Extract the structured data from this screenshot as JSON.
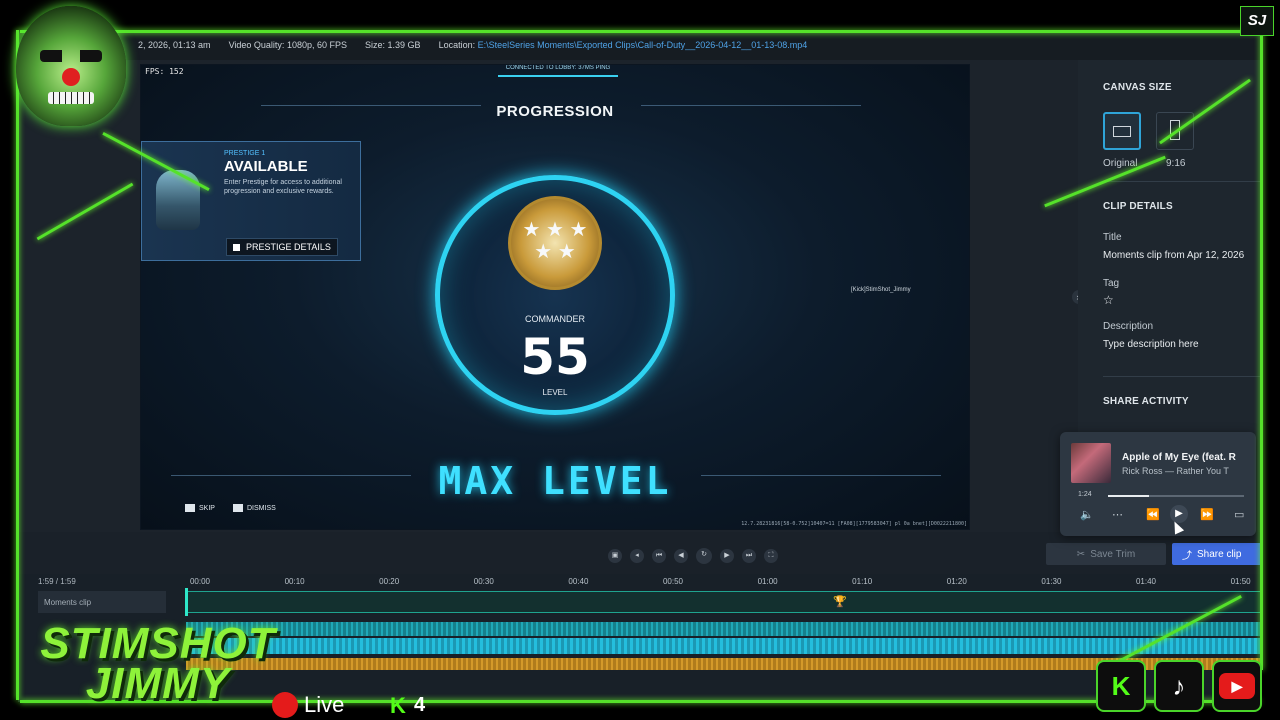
{
  "meta_bar": {
    "date": "2, 2026, 01:13 am",
    "quality_label": "Video Quality:",
    "quality_value": "1080p, 60 FPS",
    "size_label": "Size:",
    "size_value": "1.39 GB",
    "location_label": "Location:",
    "location_value": "E:\\SteelSeries Moments\\Exported Clips\\Call-of-Duty__2026-04-12__01-13-08.mp4"
  },
  "preview": {
    "fps": "FPS: 152",
    "lobby_status": "CONNECTED TO LOBBY: 37MS PING",
    "progression_title": "PROGRESSION",
    "prestige": {
      "small": "PRESTIGE 1",
      "big": "AVAILABLE",
      "desc": "Enter Prestige for access to additional progression and exclusive rewards.",
      "button": "PRESTIGE DETAILS"
    },
    "rank": {
      "stars": "★ ★ ★\n★ ★",
      "title": "COMMANDER",
      "number": "55",
      "level": "LEVEL"
    },
    "max_level": "MAX LEVEL",
    "skip": "SKIP",
    "dismiss": "DISMISS",
    "kick_tag": "[Kick]StimShot_Jimmy",
    "build": "12.7.28231816[58-0.752]10407=11 [FA08][1779583047] pl 0a bnet][D0022211800]"
  },
  "sidebar": {
    "canvas_size": "CANVAS SIZE",
    "canvas_original": "Original",
    "canvas_916": "9:16",
    "clip_details": "CLIP DETAILS",
    "title_label": "Title",
    "title_value": "Moments clip from Apr 12, 2026",
    "tag_label": "Tag",
    "description_label": "Description",
    "description_placeholder": "Type description here",
    "share_activity": "SHARE ACTIVITY"
  },
  "music": {
    "title": "Apple of My Eye (feat. R",
    "artist": "Rick Ross — Rather You T",
    "time": "1:24",
    "progress_fraction": 0.3
  },
  "transport": {
    "save_trim": "Save Trim",
    "share_clip": "Share clip"
  },
  "timeline": {
    "time_display": "1:59 / 1:59",
    "track_label": "Moments clip",
    "ticks": [
      "00:00",
      "00:10",
      "00:20",
      "00:30",
      "00:40",
      "00:50",
      "01:00",
      "01:10",
      "01:20",
      "01:30",
      "01:40",
      "01:50"
    ]
  },
  "overlay": {
    "corner_logo": "SJ",
    "brand_line1": "STIMSHOT",
    "brand_line2": "JIMMY",
    "live": "Live",
    "viewer_count": "4",
    "kick_letter": "K"
  },
  "colors": {
    "accent_cyan": "#3fe0ff",
    "share_blue": "#3f6be0",
    "overlay_green": "#55e22a",
    "live_red": "#e41b1b"
  }
}
